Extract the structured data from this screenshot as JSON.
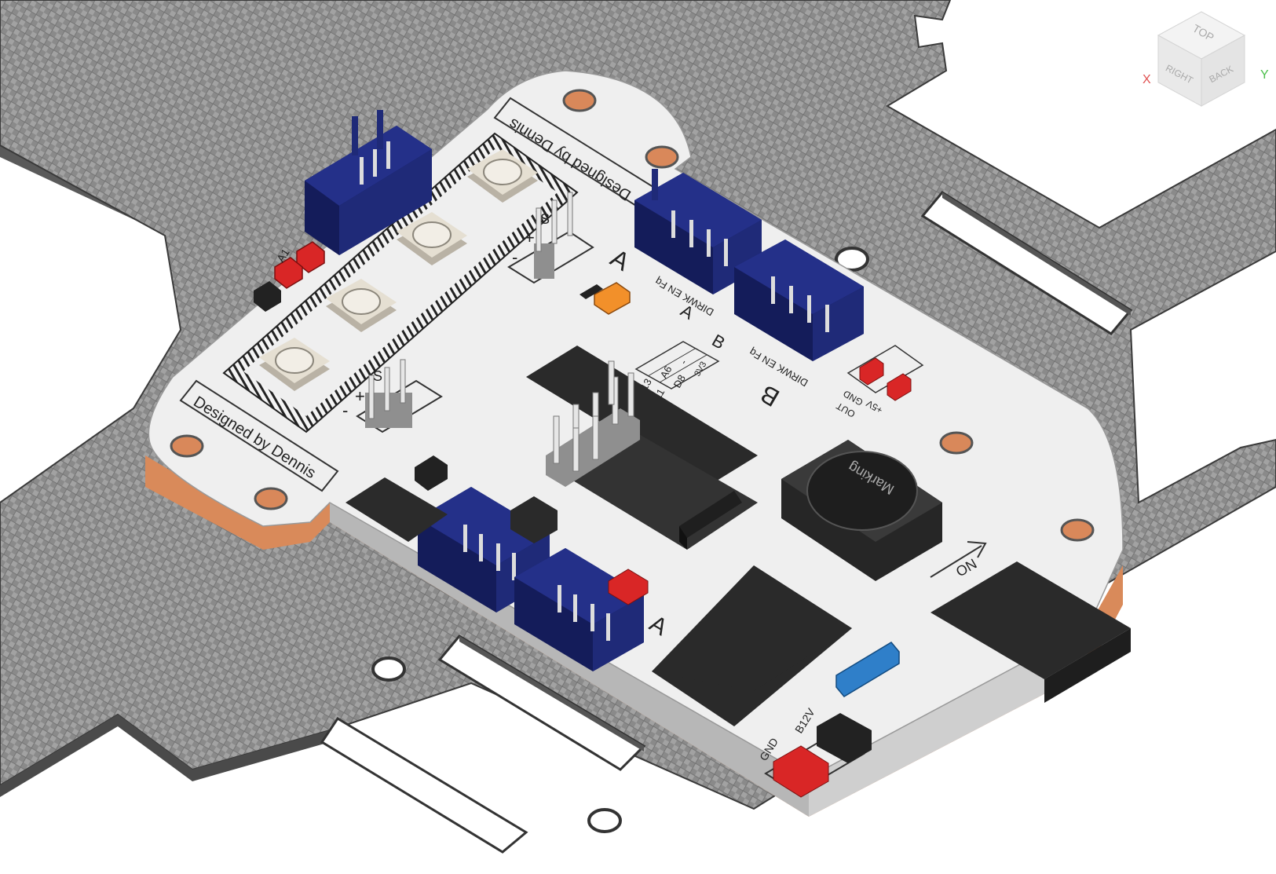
{
  "board": {
    "credit_top": "Designed by Dennis",
    "credit_left": "Designed by Dennis",
    "channel_a_big": "A",
    "channel_a_label": "A",
    "channel_b_big": "B",
    "channel_b_label": "B",
    "pins_a": "DIRWK EN Fq",
    "pins_b": "DIRWK EN Fq",
    "servo_plus_1": "+",
    "servo_minus_1": "-",
    "servo_s_1": "S",
    "servo_plus_2": "+",
    "servo_minus_2": "-",
    "servo_s_2": "S",
    "table": [
      "13",
      "11",
      "A6",
      "D8",
      "-",
      "3V3"
    ],
    "pwr_gnd": "GND",
    "pwr_out": "OUT",
    "pwr_5v": "+5V",
    "inductor_marking": "Marking",
    "switch_label": "ON",
    "batt_gnd": "GND",
    "batt_b12v": "B12V",
    "a1_label": "A1",
    "motor_a_label": "A"
  },
  "viewcube": {
    "top": "TOP",
    "right": "RIGHT",
    "back": "BACK",
    "x_axis": "X",
    "y_axis": "Y"
  },
  "colors": {
    "carbon": "#8c8c8c",
    "pcb": "#eeeeee",
    "copper": "#e6a57a",
    "connector": "#1f2a78",
    "smd": "#d92626",
    "chip": "#2b2b2b"
  }
}
